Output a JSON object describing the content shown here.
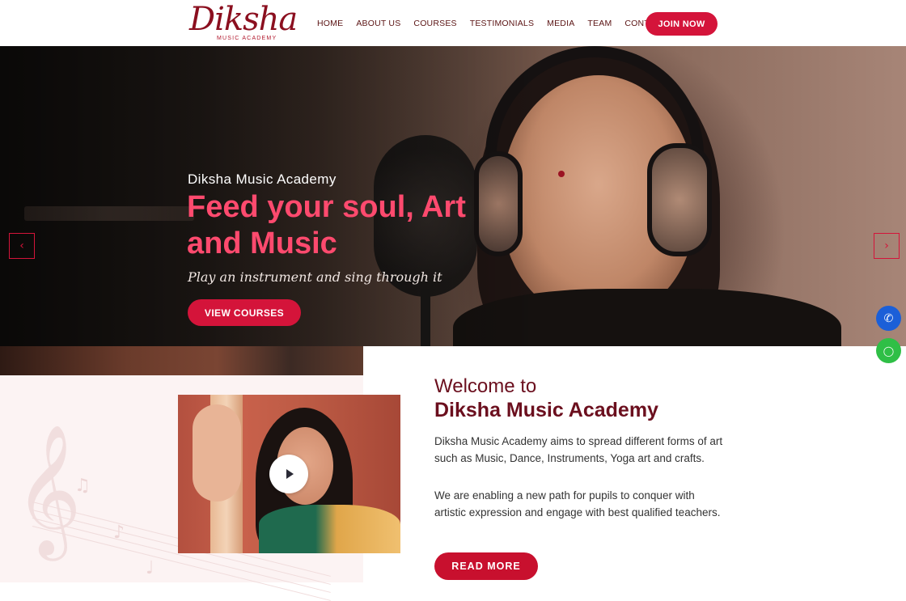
{
  "header": {
    "logo": {
      "script": "Diksha",
      "sub": "MUSIC ACADEMY"
    },
    "nav": [
      {
        "label": "HOME"
      },
      {
        "label": "ABOUT US"
      },
      {
        "label": "COURSES"
      },
      {
        "label": "TESTIMONIALS"
      },
      {
        "label": "MEDIA"
      },
      {
        "label": "TEAM"
      },
      {
        "label": "CONTACT US"
      }
    ],
    "cta_label": "JOIN NOW"
  },
  "hero": {
    "subtitle": "Diksha Music Academy",
    "title": "Feed your soul, Art and Music",
    "tagline": "Play an instrument and sing through it",
    "button_label": "VIEW COURSES",
    "prev_icon": "chevron-left-icon",
    "next_icon": "chevron-right-icon"
  },
  "floating": {
    "call_icon": "phone-icon",
    "whatsapp_icon": "whatsapp-icon"
  },
  "welcome": {
    "heading_line1": "Welcome to",
    "heading_line2": "Diksha Music Academy",
    "paragraph1": "Diksha Music Academy aims to spread different forms of art such as Music, Dance, Instruments, Yoga art and crafts.",
    "paragraph2": "We are enabling a new path for pupils to conquer with artistic expression and engage with best qualified teachers.",
    "button_label": "READ MORE",
    "video_icon": "play-icon"
  },
  "colors": {
    "accent": "#d4143a",
    "hero_title": "#ff4a6e",
    "heading": "#6b0f1e",
    "nav_text": "#5b1414",
    "call": "#1b5fd8",
    "whatsapp": "#2fbf46"
  }
}
